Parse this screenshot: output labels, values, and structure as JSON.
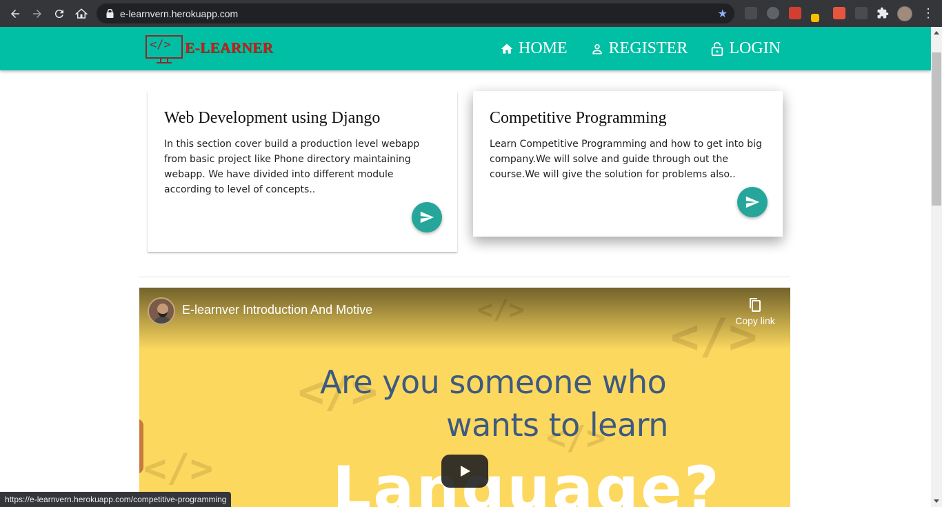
{
  "browser": {
    "url": "e-learnvern.herokuapp.com",
    "status_url": "https://e-learnvern.herokuapp.com/competitive-programming"
  },
  "site": {
    "logo_text": "E-LEARNER",
    "logo_code": "</>",
    "nav": [
      {
        "label": "HOME",
        "icon": "home-icon"
      },
      {
        "label": "REGISTER",
        "icon": "person-icon"
      },
      {
        "label": "LOGIN",
        "icon": "lock-icon"
      }
    ],
    "colors": {
      "nav_bg": "#00bfa5",
      "fab": "#26a69a",
      "logo_red": "#d8151d"
    }
  },
  "cards": [
    {
      "title": "Web Development using Django",
      "text": "In this section cover build a production level webapp from basic project like Phone directory maintaining webapp. We have divided into different module according to level of concepts.."
    },
    {
      "title": "Competitive Programming",
      "text": "Learn Competitive Programming and how to get into big company.We will solve and guide through out the course.We will give the solution for problems also.."
    }
  ],
  "video": {
    "title": "E-learnver Introduction And Motive",
    "copy_link": "Copy link",
    "line1": "Are you someone who",
    "line2": "wants to learn",
    "line3": "Language?"
  }
}
